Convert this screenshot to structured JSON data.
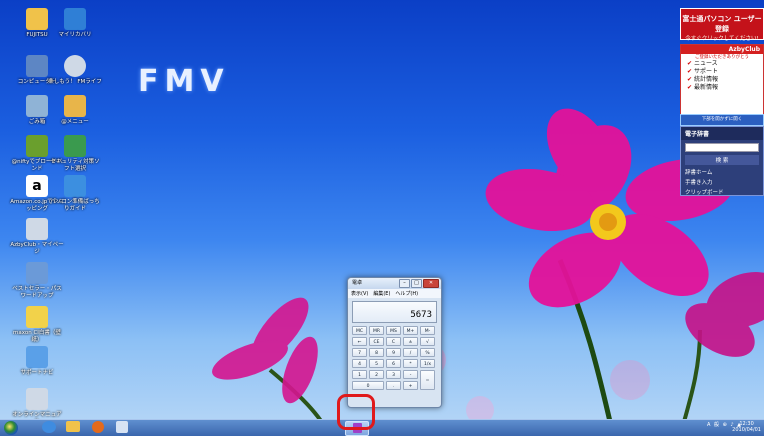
{
  "desktop": {
    "brand": "FMV",
    "icons": [
      {
        "label": "FUJITSU",
        "glyph": "folder-icon",
        "color": "#f0c24a"
      },
      {
        "label": "マイリカバリ",
        "glyph": "recovery-icon",
        "color": "#2f7fd6"
      },
      {
        "label": "コンピューター",
        "glyph": "computer-icon",
        "color": "#5d86c4"
      },
      {
        "label": "楽しもう！ FMライフ",
        "glyph": "cd-icon",
        "color": "#cfd9e6"
      },
      {
        "label": "ごみ箱",
        "glyph": "recycle-bin-icon",
        "color": "#8fb3d6"
      },
      {
        "label": "@メニュー",
        "glyph": "menu-icon",
        "color": "#e8b54a"
      },
      {
        "label": "@niftyでブロードバンド",
        "glyph": "nifty-icon",
        "color": "#6a9f2d"
      },
      {
        "label": "セキュリティ対策ソフト選択",
        "glyph": "security-icon",
        "color": "#3a9a4e"
      },
      {
        "label": "Amazon.co.jpでショッピング",
        "glyph": "amazon-icon",
        "color": "#ffffff"
      },
      {
        "label": "パソコン準備ばっちりガイド",
        "glyph": "guide-icon",
        "color": "#3c8fe0"
      },
      {
        "label": "AzbyClub・マイページ",
        "glyph": "azbyclub-icon",
        "color": "#cfd9e6"
      },
      {
        "label": "ベストセラー・パスワードアップ",
        "glyph": "upgrade-icon",
        "color": "#6b9ad8"
      },
      {
        "label": "maxon CI白書（壁紙）",
        "glyph": "wallpaper-icon",
        "color": "#f2d24a"
      },
      {
        "label": "サポートナビ",
        "glyph": "support-icon",
        "color": "#5aa0e8"
      },
      {
        "label": "オンラインマニュアル",
        "glyph": "manual-icon",
        "color": "#cfd9e6"
      }
    ]
  },
  "panel": {
    "register_line1": "富士通パソコン ユーザー登録",
    "register_line2": "今すぐクリックしてください!",
    "azby_brand": "AzbyClub",
    "azby_tag": "ご登録いただきありがとう",
    "azby_items": [
      "ニュース",
      "サポート",
      "統計情報",
      "最新情報"
    ],
    "azby_button": "下部を開かずに開く",
    "dict_title": "電子辞書",
    "dict_button": "検 索",
    "dict_links": [
      "辞書ホーム",
      "手書き入力",
      "クリップボード"
    ]
  },
  "calculator": {
    "title": "電卓",
    "menu": [
      "表示(V)",
      "編集(E)",
      "ヘルプ(H)"
    ],
    "display": "5673",
    "keys": [
      "MC",
      "MR",
      "MS",
      "M+",
      "M-",
      "←",
      "CE",
      "C",
      "±",
      "√",
      "7",
      "8",
      "9",
      "/",
      "%",
      "4",
      "5",
      "6",
      "*",
      "1/x",
      "1",
      "2",
      "3",
      "-",
      "=",
      "0",
      ".",
      "+"
    ]
  },
  "taskbar": {
    "tray": "A 般 ⊕ ♪ ▲",
    "time": "12:30",
    "date": "2010/04/01"
  },
  "colors": {
    "accent": "#e0191b",
    "taskbar": "#3a66ad"
  }
}
